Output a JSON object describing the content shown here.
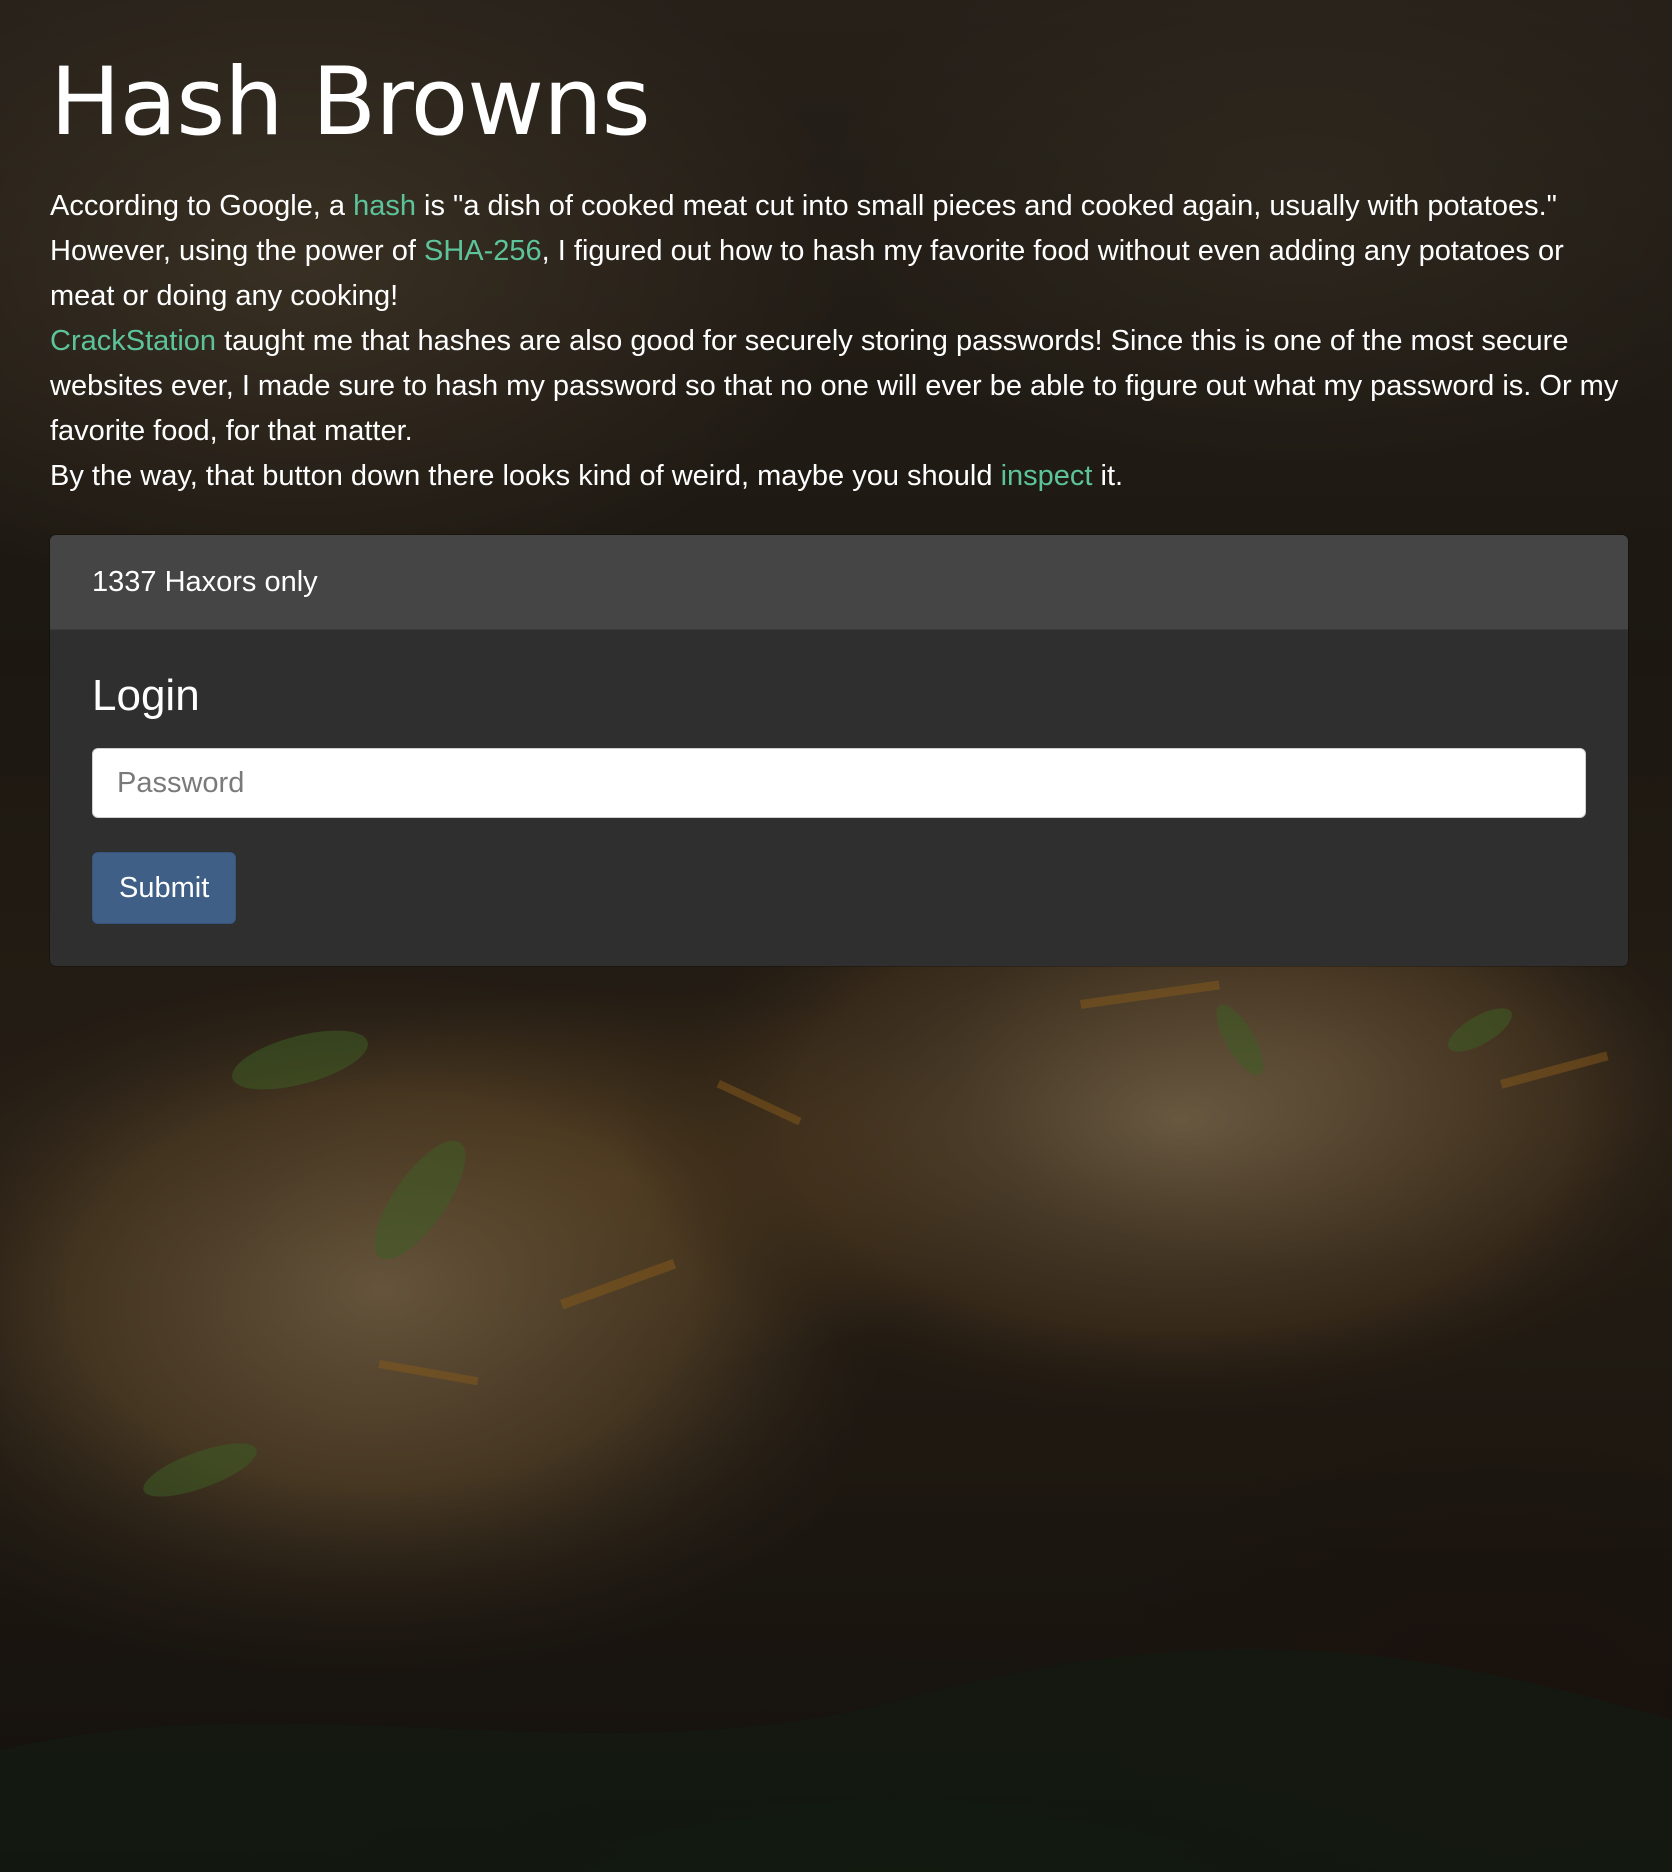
{
  "page": {
    "title": "Hash Browns"
  },
  "intro": {
    "p1_before_link": "According to Google, a ",
    "p1_link": "hash",
    "p1_after_link": " is \"a dish of cooked meat cut into small pieces and cooked again, usually with potatoes.\" However, using the power of ",
    "p1_link2": "SHA-256",
    "p1_end": ", I figured out how to hash my favorite food without even adding any potatoes or meat or doing any cooking!",
    "p2_link": "CrackStation",
    "p2_text": " taught me that hashes are also good for securely storing passwords! Since this is one of the most secure websites ever, I made sure to hash my password so that no one will ever be able to figure out what my password is. Or my favorite food, for that matter.",
    "p3_before_link": "By the way, that button down there looks kind of weird, maybe you should ",
    "p3_link": "inspect",
    "p3_after_link": " it."
  },
  "card": {
    "header": "1337 Haxors only",
    "title": "Login",
    "password_placeholder": "Password",
    "password_value": "",
    "submit_label": "Submit"
  },
  "colors": {
    "link": "#5cc39a",
    "card_header_bg": "#454545",
    "card_body_bg": "#2f2f2f",
    "button_bg": "#3f5f87"
  }
}
